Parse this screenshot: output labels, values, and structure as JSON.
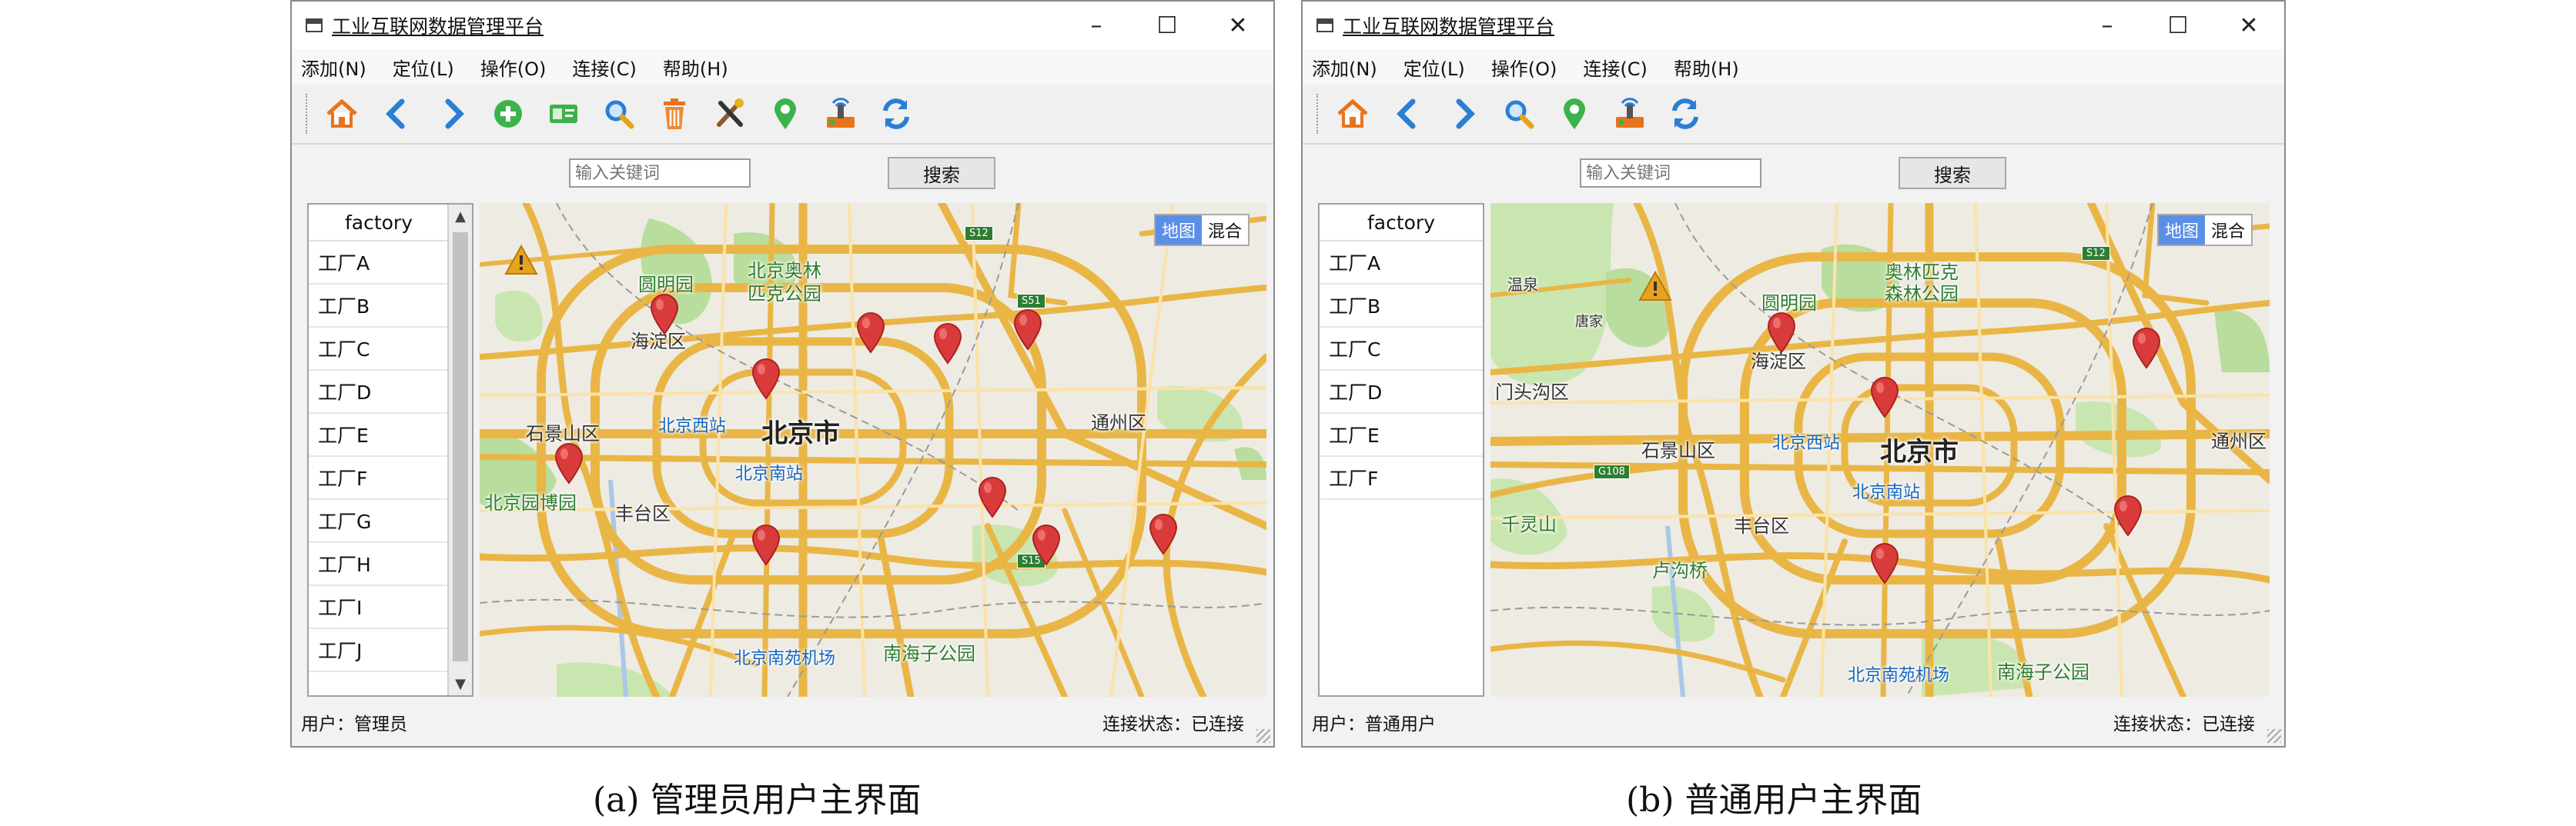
{
  "window": {
    "title": "工业互联网数据管理平台",
    "controls": [
      "–",
      "☐",
      "✕"
    ]
  },
  "search": {
    "placeholder": "输入关键词",
    "button": "搜索"
  },
  "map": {
    "toggle": [
      "地图",
      "混合"
    ],
    "labels": {
      "yuanmingyuan": "圆明园",
      "olympic": "北京奥林匹克公园",
      "olympic_a": "北京奥林",
      "olympic_b": "匹克公园",
      "olympic_forest_a": "奥林匹克",
      "olympic_forest_b": "森林公园",
      "haidian": "海淀区",
      "beijing": "北京市",
      "shijingshan": "石景山区",
      "west_station": "北京西站",
      "south_station": "北京南站",
      "fengtai": "丰台区",
      "tongzhou": "通州区",
      "garden_expo": "北京园博园",
      "nanyuan": "北京南苑机场",
      "nanhaizi": "南海子公园",
      "mentougou": "门头沟区",
      "qianlingshan": "千灵山",
      "lugouqiao": "卢沟桥",
      "wenquan": "温泉",
      "tangjia": "唐家"
    },
    "road_signs": [
      "S12",
      "S51",
      "S15",
      "G108"
    ]
  },
  "panel_a": {
    "menus": [
      "添加(N)",
      "定位(L)",
      "操作(O)",
      "连接(C)",
      "帮助(H)"
    ],
    "toolbar_icons": [
      "home-icon",
      "back-icon",
      "forward-icon",
      "add-icon",
      "card-icon",
      "search-icon",
      "trash-icon",
      "tools-icon",
      "location-icon",
      "device-icon",
      "refresh-icon"
    ],
    "list_header": "factory",
    "factories": [
      "工厂A",
      "工厂B",
      "工厂C",
      "工厂D",
      "工厂E",
      "工厂F",
      "工厂G",
      "工厂H",
      "工厂I",
      "工厂J"
    ],
    "status_user": "用户：管理员",
    "status_conn": "连接状态：已连接",
    "caption": "(a) 管理员用户主界面"
  },
  "panel_b": {
    "menus": [
      "添加(N)",
      "定位(L)",
      "操作(O)",
      "连接(C)",
      "帮助(H)"
    ],
    "toolbar_icons": [
      "home-icon",
      "back-icon",
      "forward-icon",
      "search-icon",
      "location-icon",
      "device-icon",
      "refresh-icon"
    ],
    "list_header": "factory",
    "factories": [
      "工厂A",
      "工厂B",
      "工厂C",
      "工厂D",
      "工厂E",
      "工厂F"
    ],
    "status_user": "用户：普通用户",
    "status_conn": "连接状态：已连接",
    "caption": "(b) 普通用户主界面"
  },
  "colors": {
    "road": "#e9b646",
    "park": "#b9dd9d",
    "pin": "#d93b3b",
    "toggle_active": "#5b8fe6"
  }
}
